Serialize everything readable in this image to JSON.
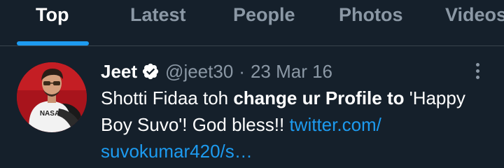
{
  "tabs": [
    {
      "label": "Top",
      "active": true
    },
    {
      "label": "Latest",
      "active": false
    },
    {
      "label": "People",
      "active": false
    },
    {
      "label": "Photos",
      "active": false
    },
    {
      "label": "Videos",
      "active": false
    }
  ],
  "tweet": {
    "author_name": "Jeet",
    "verified": true,
    "handle": "@jeet30",
    "separator": "·",
    "date": "23 Mar 16",
    "text_1": "Shotti Fidaa toh ",
    "text_bold": "change ur Profile to",
    "text_2": " 'Happy Boy Suvo'! God bless!! ",
    "link_line_1": "twitter.com/",
    "link_line_2": "suvokumar420/s…",
    "avatar_label": "NASA"
  },
  "colors": {
    "background": "#15202b",
    "accent": "#1d9bf0",
    "muted": "#8b98a5",
    "divider": "#38444d"
  },
  "icons": [
    "verified-badge-icon",
    "more-options-icon"
  ]
}
